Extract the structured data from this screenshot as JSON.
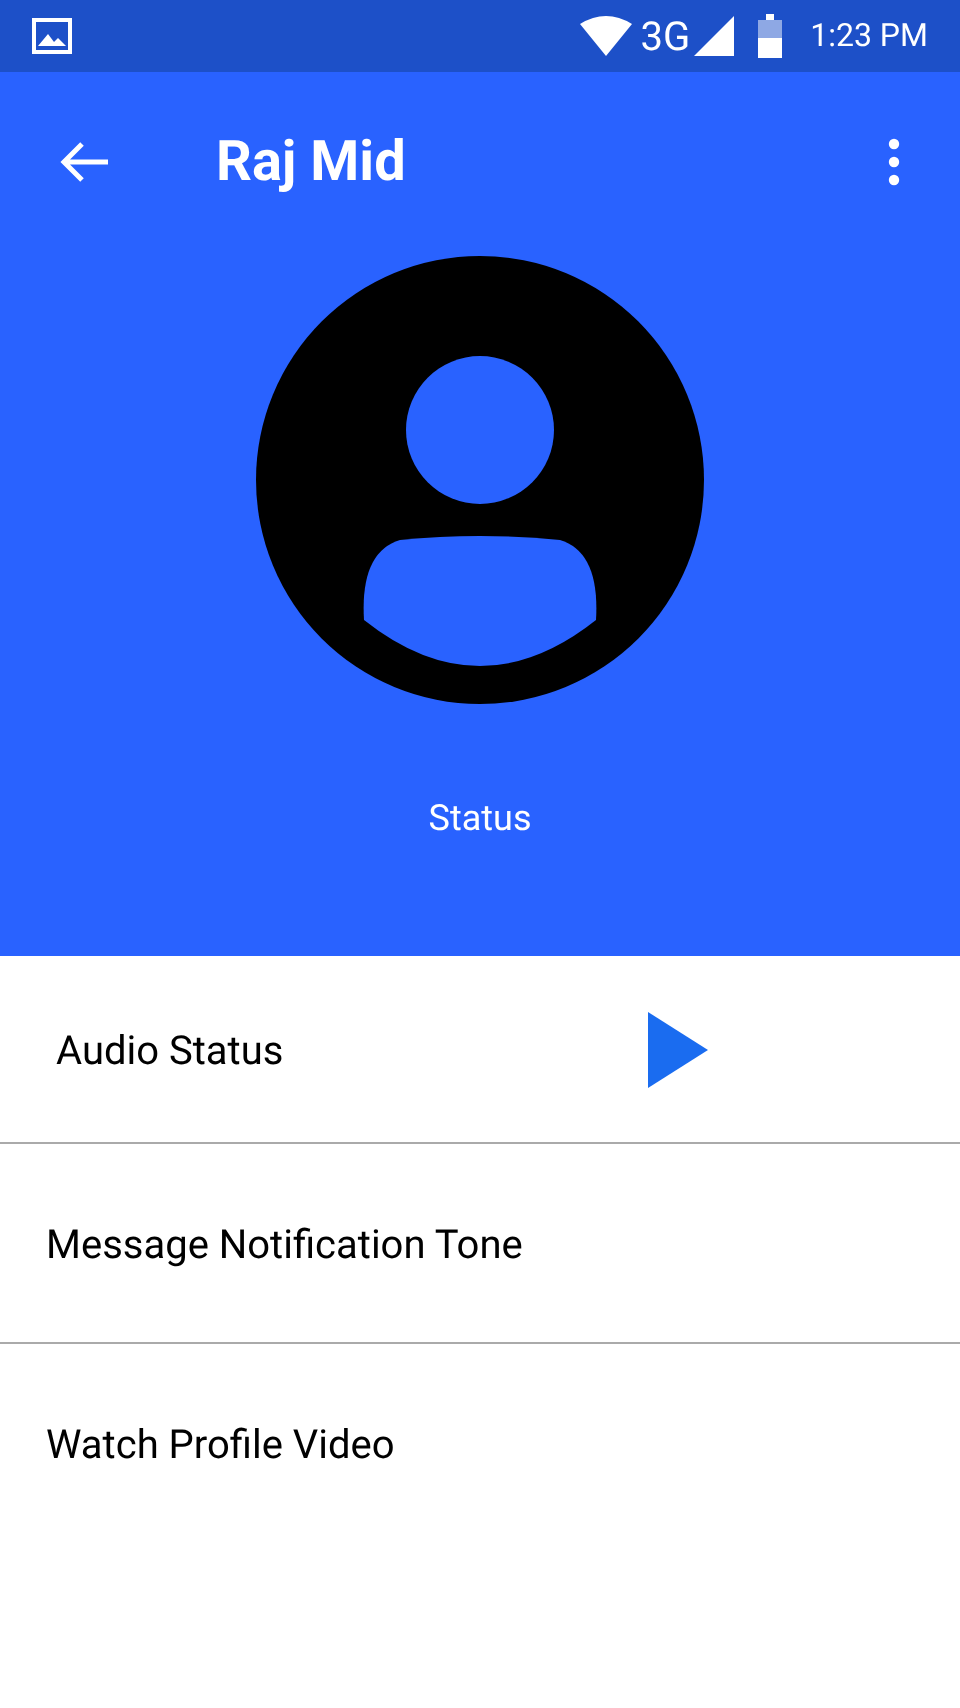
{
  "status_bar": {
    "network": "3G",
    "time": "1:23 PM"
  },
  "header": {
    "title": "Raj Mid",
    "status": "Status"
  },
  "rows": [
    {
      "kind": "audio",
      "label": "Audio Status"
    },
    {
      "kind": "plain",
      "label": "Message Notification Tone"
    },
    {
      "kind": "plain",
      "label": "Watch Profile Video"
    }
  ]
}
